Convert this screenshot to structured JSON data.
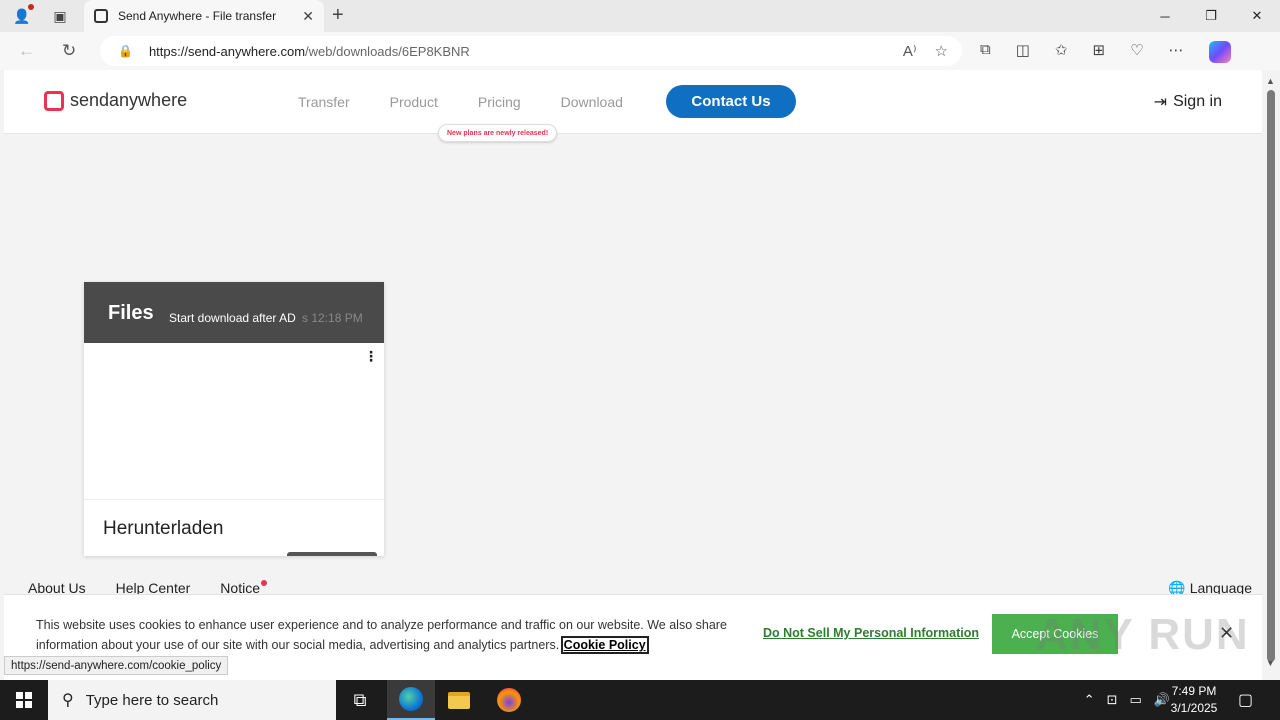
{
  "browser": {
    "tab_title": "Send Anywhere - File transfer",
    "url_host": "https://send-anywhere.com",
    "url_path": "/web/downloads/6EP8KBNR",
    "status_url": "https://send-anywhere.com/cookie_policy"
  },
  "site": {
    "logo_text": "sendanywhere",
    "nav": [
      "Transfer",
      "Product",
      "Pricing",
      "Download"
    ],
    "new_badge": "New plans are newly released!",
    "contact_label": "Contact Us",
    "signin_label": "Sign in"
  },
  "card": {
    "title": "Files",
    "subtitle": "Start download after AD",
    "time": "s 12:18 PM",
    "footer_title": "Herunterladen"
  },
  "footer": {
    "links": [
      "About Us",
      "Help Center",
      "Notice"
    ],
    "language": "Language"
  },
  "cookie": {
    "text": "This website uses cookies to enhance user experience and to analyze performance and traffic on our website. We also share information about your use of our site with our social media, advertising and analytics partners.",
    "policy_link": "Cookie Policy",
    "dns_link": "Do Not Sell My Personal Information",
    "accept_label": "Accept Cookies"
  },
  "watermark": "ANY RUN",
  "taskbar": {
    "search_placeholder": "Type here to search",
    "time": "7:49 PM",
    "date": "3/1/2025"
  },
  "colors": {
    "brand_red": "#e8344e",
    "contact_blue": "#0e6fc3",
    "accept_green": "#4caf50",
    "card_header": "#4a4a4a"
  }
}
